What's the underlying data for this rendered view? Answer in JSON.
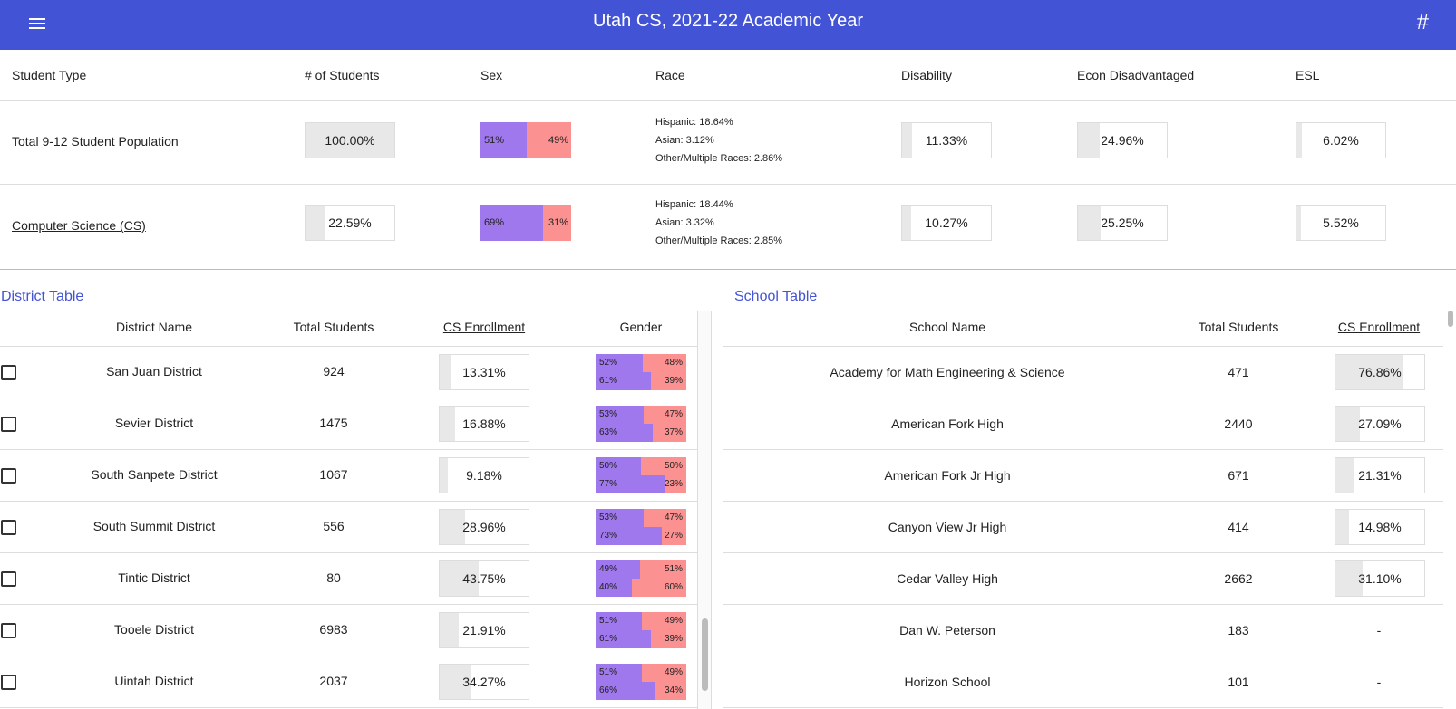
{
  "header": {
    "title": "Utah CS, 2021-22 Academic Year",
    "menu_icon": "hamburger-icon",
    "hash_label": "#"
  },
  "summary": {
    "columns": [
      "Student Type",
      "# of Students",
      "Sex",
      "Race",
      "Disability",
      "Econ Disadvantaged",
      "ESL"
    ],
    "rows": [
      {
        "label": "Total 9-12 Student Population",
        "students": "100.00%",
        "students_value": 100,
        "male": "51%",
        "male_value": 51,
        "female": "49%",
        "race": [
          "Hispanic: 18.64%",
          "Asian: 3.12%",
          "Other/Multiple Races: 2.86%"
        ],
        "disability": "11.33%",
        "disability_value": 11.33,
        "econ": "24.96%",
        "econ_value": 24.96,
        "esl": "6.02%",
        "esl_value": 6.02
      },
      {
        "label": "Computer Science (CS)",
        "students": "22.59%",
        "students_value": 22.59,
        "male": "69%",
        "male_value": 69,
        "female": "31%",
        "race": [
          "Hispanic: 18.44%",
          "Asian: 3.32%",
          "Other/Multiple Races: 2.85%"
        ],
        "disability": "10.27%",
        "disability_value": 10.27,
        "econ": "25.25%",
        "econ_value": 25.25,
        "esl": "5.52%",
        "esl_value": 5.52
      }
    ]
  },
  "district_table": {
    "title": "District Table",
    "columns": [
      "District Name",
      "Total Students",
      "CS Enrollment",
      "Gender"
    ],
    "rows": [
      {
        "name": "San Juan District",
        "total": "924",
        "cs": "13.31%",
        "cs_value": 13.31,
        "gt": [
          "52%",
          "48%"
        ],
        "gb": [
          "61%",
          "39%"
        ]
      },
      {
        "name": "Sevier District",
        "total": "1475",
        "cs": "16.88%",
        "cs_value": 16.88,
        "gt": [
          "53%",
          "47%"
        ],
        "gb": [
          "63%",
          "37%"
        ]
      },
      {
        "name": "South Sanpete District",
        "total": "1067",
        "cs": "9.18%",
        "cs_value": 9.18,
        "gt": [
          "50%",
          "50%"
        ],
        "gb": [
          "77%",
          "23%"
        ]
      },
      {
        "name": "South Summit District",
        "total": "556",
        "cs": "28.96%",
        "cs_value": 28.96,
        "gt": [
          "53%",
          "47%"
        ],
        "gb": [
          "73%",
          "27%"
        ]
      },
      {
        "name": "Tintic District",
        "total": "80",
        "cs": "43.75%",
        "cs_value": 43.75,
        "gt": [
          "49%",
          "51%"
        ],
        "gb": [
          "40%",
          "60%"
        ]
      },
      {
        "name": "Tooele District",
        "total": "6983",
        "cs": "21.91%",
        "cs_value": 21.91,
        "gt": [
          "51%",
          "49%"
        ],
        "gb": [
          "61%",
          "39%"
        ]
      },
      {
        "name": "Uintah District",
        "total": "2037",
        "cs": "34.27%",
        "cs_value": 34.27,
        "gt": [
          "51%",
          "49%"
        ],
        "gb": [
          "66%",
          "34%"
        ]
      }
    ]
  },
  "school_table": {
    "title": "School Table",
    "columns": [
      "School Name",
      "Total Students",
      "CS Enrollment"
    ],
    "rows": [
      {
        "name": "Academy for Math Engineering & Science",
        "total": "471",
        "cs": "76.86%",
        "cs_value": 76.86
      },
      {
        "name": "American Fork High",
        "total": "2440",
        "cs": "27.09%",
        "cs_value": 27.09
      },
      {
        "name": "American Fork Jr High",
        "total": "671",
        "cs": "21.31%",
        "cs_value": 21.31
      },
      {
        "name": "Canyon View Jr High",
        "total": "414",
        "cs": "14.98%",
        "cs_value": 14.98
      },
      {
        "name": "Cedar Valley High",
        "total": "2662",
        "cs": "31.10%",
        "cs_value": 31.1
      },
      {
        "name": "Dan W. Peterson",
        "total": "183",
        "cs": "-"
      },
      {
        "name": "Horizon School",
        "total": "101",
        "cs": "-"
      }
    ]
  },
  "colors": {
    "header": "#4353d6",
    "male": "#a078ee",
    "female": "#fb9191",
    "bar_fill": "#e8e8e8"
  }
}
